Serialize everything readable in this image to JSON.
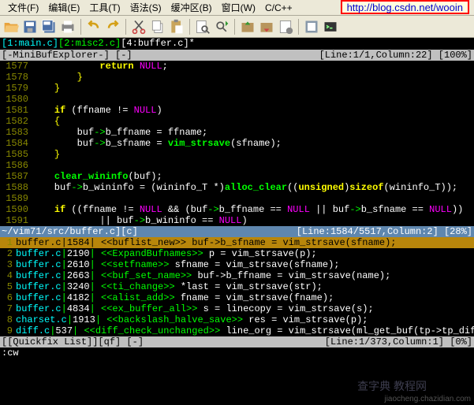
{
  "menu": {
    "file": "文件(F)",
    "edit": "编辑(E)",
    "tools": "工具(T)",
    "syntax": "语法(S)",
    "buffers": "缓冲区(B)",
    "window": "窗口(W)",
    "cc": "C/C++"
  },
  "url": "http://blog.csdn.net/wooin",
  "tabs": {
    "t1": "[1:main.c]",
    "t2": "[2:misc2.c]",
    "t3": "[4:buffer.c]*"
  },
  "status_top": {
    "left": "[-MiniBufExplorer-] [-]",
    "right": "[Line:1/1,Column:22] [100%]"
  },
  "code_lines": [
    {
      "n": "1577",
      "html": "            <span class='kw'>return</span> <span class='null'>NULL</span>;"
    },
    {
      "n": "1578",
      "html": "        <span class='punct'>}</span>"
    },
    {
      "n": "1579",
      "html": "    <span class='punct'>}</span>"
    },
    {
      "n": "1580",
      "html": ""
    },
    {
      "n": "1581",
      "html": "    <span class='kw'>if</span> (ffname != <span class='null'>NULL</span>)"
    },
    {
      "n": "1582",
      "html": "    <span class='punct'>{</span>"
    },
    {
      "n": "1583",
      "html": "        buf<span class='op'>-&gt;</span>b_ffname = ffname;"
    },
    {
      "n": "1584",
      "html": "        buf<span class='op'>-&gt;</span>b_sfname = <span class='func'>vim_strsave</span>(sfname);"
    },
    {
      "n": "1585",
      "html": "    <span class='punct'>}</span>"
    },
    {
      "n": "1586",
      "html": ""
    },
    {
      "n": "1587",
      "html": "    <span class='func'>clear_wininfo</span>(buf);"
    },
    {
      "n": "1588",
      "html": "    buf<span class='op'>-&gt;</span>b_wininfo = (wininfo_T *)<span class='func'>alloc_clear</span>((<span class='kw'>unsigned</span>)<span class='kw'>sizeof</span>(wininfo_T));"
    },
    {
      "n": "1589",
      "html": ""
    },
    {
      "n": "1590",
      "html": "    <span class='kw'>if</span> ((ffname != <span class='null'>NULL</span> &amp;&amp; (buf<span class='op'>-&gt;</span>b_ffname == <span class='null'>NULL</span> || buf<span class='op'>-&gt;</span>b_sfname == <span class='null'>NULL</span>))"
    },
    {
      "n": "1591",
      "html": "            || buf<span class='op'>-&gt;</span>b_wininfo == <span class='null'>NULL</span>)"
    }
  ],
  "status_mid": {
    "left": "~/vim71/src/buffer.c][c]",
    "right": "[Line:1584/5517,Column:2] [28%]"
  },
  "qf_lines": [
    {
      "n": "1",
      "sel": true,
      "fn": "buffer.c",
      "ln": "1584",
      "tag": "<<buflist_new>>",
      "txt": " buf->b_sfname = vim_strsave(sfname);"
    },
    {
      "n": "2",
      "fn": "buffer.c",
      "ln": "2190",
      "tag": "<<ExpandBufnames>>",
      "txt": " p = vim_strsave(p);"
    },
    {
      "n": "3",
      "fn": "buffer.c",
      "ln": "2610",
      "tag": "<<setfname>>",
      "txt": " sfname = vim_strsave(sfname);"
    },
    {
      "n": "4",
      "fn": "buffer.c",
      "ln": "2663",
      "tag": "<<buf_set_name>>",
      "txt": " buf->b_ffname = vim_strsave(name);"
    },
    {
      "n": "5",
      "fn": "buffer.c",
      "ln": "3240",
      "tag": "<<ti_change>>",
      "txt": " *last = vim_strsave(str);"
    },
    {
      "n": "6",
      "fn": "buffer.c",
      "ln": "4182",
      "tag": "<<alist_add>>",
      "txt": " fname = vim_strsave(fname);"
    },
    {
      "n": "7",
      "fn": "buffer.c",
      "ln": "4834",
      "tag": "<<ex_buffer_all>>",
      "txt": " s = linecopy = vim_strsave(s);"
    },
    {
      "n": "8",
      "fn": "charset.c",
      "ln": "1913",
      "tag": "<<backslash_halve_save>>",
      "txt": " res = vim_strsave(p);"
    },
    {
      "n": "9",
      "fn": "diff.c",
      "ln": "537",
      "tag": "<<diff_check_unchanged>>",
      "txt": " line_org = vim_strsave(ml_get_buf(tp->tp_diffbuf[i_org],"
    }
  ],
  "status_bot": {
    "left": "[[Quickfix List]][qf] [-]",
    "right": "[Line:1/373,Column:1] [0%]"
  },
  "cmdline": ":cw",
  "watermark": "jiaocheng.chazidian.com",
  "logo": "查字典 教程网"
}
